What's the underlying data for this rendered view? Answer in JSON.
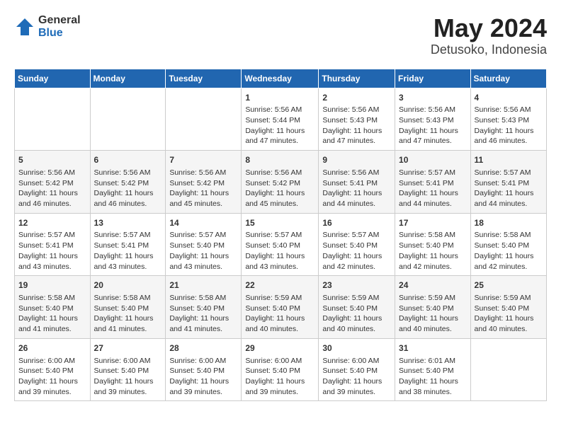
{
  "header": {
    "logo_general": "General",
    "logo_blue": "Blue",
    "title": "May 2024",
    "subtitle": "Detusoko, Indonesia"
  },
  "weekdays": [
    "Sunday",
    "Monday",
    "Tuesday",
    "Wednesday",
    "Thursday",
    "Friday",
    "Saturday"
  ],
  "weeks": [
    [
      {
        "day": "",
        "info": ""
      },
      {
        "day": "",
        "info": ""
      },
      {
        "day": "",
        "info": ""
      },
      {
        "day": "1",
        "info": "Sunrise: 5:56 AM\nSunset: 5:44 PM\nDaylight: 11 hours\nand 47 minutes."
      },
      {
        "day": "2",
        "info": "Sunrise: 5:56 AM\nSunset: 5:43 PM\nDaylight: 11 hours\nand 47 minutes."
      },
      {
        "day": "3",
        "info": "Sunrise: 5:56 AM\nSunset: 5:43 PM\nDaylight: 11 hours\nand 47 minutes."
      },
      {
        "day": "4",
        "info": "Sunrise: 5:56 AM\nSunset: 5:43 PM\nDaylight: 11 hours\nand 46 minutes."
      }
    ],
    [
      {
        "day": "5",
        "info": "Sunrise: 5:56 AM\nSunset: 5:42 PM\nDaylight: 11 hours\nand 46 minutes."
      },
      {
        "day": "6",
        "info": "Sunrise: 5:56 AM\nSunset: 5:42 PM\nDaylight: 11 hours\nand 46 minutes."
      },
      {
        "day": "7",
        "info": "Sunrise: 5:56 AM\nSunset: 5:42 PM\nDaylight: 11 hours\nand 45 minutes."
      },
      {
        "day": "8",
        "info": "Sunrise: 5:56 AM\nSunset: 5:42 PM\nDaylight: 11 hours\nand 45 minutes."
      },
      {
        "day": "9",
        "info": "Sunrise: 5:56 AM\nSunset: 5:41 PM\nDaylight: 11 hours\nand 44 minutes."
      },
      {
        "day": "10",
        "info": "Sunrise: 5:57 AM\nSunset: 5:41 PM\nDaylight: 11 hours\nand 44 minutes."
      },
      {
        "day": "11",
        "info": "Sunrise: 5:57 AM\nSunset: 5:41 PM\nDaylight: 11 hours\nand 44 minutes."
      }
    ],
    [
      {
        "day": "12",
        "info": "Sunrise: 5:57 AM\nSunset: 5:41 PM\nDaylight: 11 hours\nand 43 minutes."
      },
      {
        "day": "13",
        "info": "Sunrise: 5:57 AM\nSunset: 5:41 PM\nDaylight: 11 hours\nand 43 minutes."
      },
      {
        "day": "14",
        "info": "Sunrise: 5:57 AM\nSunset: 5:40 PM\nDaylight: 11 hours\nand 43 minutes."
      },
      {
        "day": "15",
        "info": "Sunrise: 5:57 AM\nSunset: 5:40 PM\nDaylight: 11 hours\nand 43 minutes."
      },
      {
        "day": "16",
        "info": "Sunrise: 5:57 AM\nSunset: 5:40 PM\nDaylight: 11 hours\nand 42 minutes."
      },
      {
        "day": "17",
        "info": "Sunrise: 5:58 AM\nSunset: 5:40 PM\nDaylight: 11 hours\nand 42 minutes."
      },
      {
        "day": "18",
        "info": "Sunrise: 5:58 AM\nSunset: 5:40 PM\nDaylight: 11 hours\nand 42 minutes."
      }
    ],
    [
      {
        "day": "19",
        "info": "Sunrise: 5:58 AM\nSunset: 5:40 PM\nDaylight: 11 hours\nand 41 minutes."
      },
      {
        "day": "20",
        "info": "Sunrise: 5:58 AM\nSunset: 5:40 PM\nDaylight: 11 hours\nand 41 minutes."
      },
      {
        "day": "21",
        "info": "Sunrise: 5:58 AM\nSunset: 5:40 PM\nDaylight: 11 hours\nand 41 minutes."
      },
      {
        "day": "22",
        "info": "Sunrise: 5:59 AM\nSunset: 5:40 PM\nDaylight: 11 hours\nand 40 minutes."
      },
      {
        "day": "23",
        "info": "Sunrise: 5:59 AM\nSunset: 5:40 PM\nDaylight: 11 hours\nand 40 minutes."
      },
      {
        "day": "24",
        "info": "Sunrise: 5:59 AM\nSunset: 5:40 PM\nDaylight: 11 hours\nand 40 minutes."
      },
      {
        "day": "25",
        "info": "Sunrise: 5:59 AM\nSunset: 5:40 PM\nDaylight: 11 hours\nand 40 minutes."
      }
    ],
    [
      {
        "day": "26",
        "info": "Sunrise: 6:00 AM\nSunset: 5:40 PM\nDaylight: 11 hours\nand 39 minutes."
      },
      {
        "day": "27",
        "info": "Sunrise: 6:00 AM\nSunset: 5:40 PM\nDaylight: 11 hours\nand 39 minutes."
      },
      {
        "day": "28",
        "info": "Sunrise: 6:00 AM\nSunset: 5:40 PM\nDaylight: 11 hours\nand 39 minutes."
      },
      {
        "day": "29",
        "info": "Sunrise: 6:00 AM\nSunset: 5:40 PM\nDaylight: 11 hours\nand 39 minutes."
      },
      {
        "day": "30",
        "info": "Sunrise: 6:00 AM\nSunset: 5:40 PM\nDaylight: 11 hours\nand 39 minutes."
      },
      {
        "day": "31",
        "info": "Sunrise: 6:01 AM\nSunset: 5:40 PM\nDaylight: 11 hours\nand 38 minutes."
      },
      {
        "day": "",
        "info": ""
      }
    ]
  ]
}
